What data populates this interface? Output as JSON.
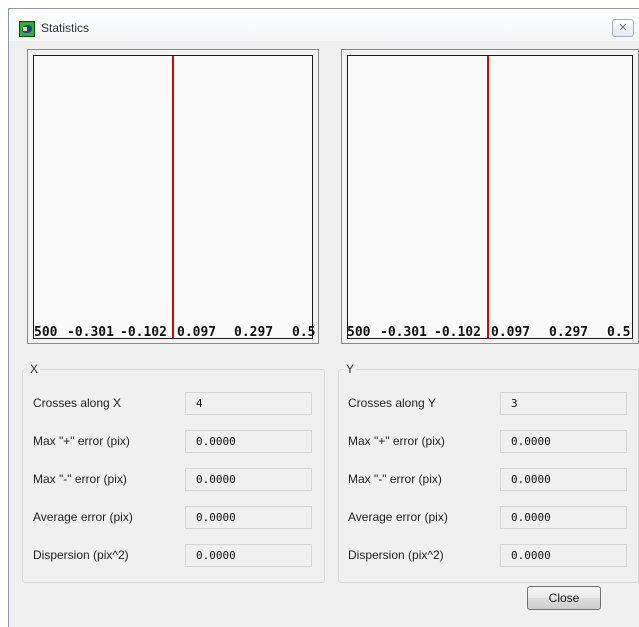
{
  "window": {
    "title": "Statistics",
    "close_glyph": "✕",
    "icon": "app-statistics-icon"
  },
  "plots": [
    {
      "ticks": [
        "500",
        "-0.301",
        "-0.102",
        "0.097",
        "0.297",
        "0.5"
      ],
      "line_color": "#e00000"
    },
    {
      "ticks": [
        "500",
        "-0.301",
        "-0.102",
        "0.097",
        "0.297",
        "0.5"
      ],
      "line_color": "#e00000"
    }
  ],
  "x_group": {
    "title": "X",
    "rows": [
      {
        "label": "Crosses along X",
        "value": "4"
      },
      {
        "label": "Max \"+\" error (pix)",
        "value": "0.0000"
      },
      {
        "label": "Max \"-\" error (pix)",
        "value": "0.0000"
      },
      {
        "label": "Average error (pix)",
        "value": "0.0000"
      },
      {
        "label": "Dispersion (pix^2)",
        "value": "0.0000"
      }
    ]
  },
  "y_group": {
    "title": "Y",
    "rows": [
      {
        "label": "Crosses along Y",
        "value": "3"
      },
      {
        "label": "Max \"+\" error (pix)",
        "value": "0.0000"
      },
      {
        "label": "Max \"-\" error (pix)",
        "value": "0.0000"
      },
      {
        "label": "Average error (pix)",
        "value": "0.0000"
      },
      {
        "label": "Dispersion (pix^2)",
        "value": "0.0000"
      }
    ]
  },
  "buttons": {
    "close_label": "Close"
  }
}
